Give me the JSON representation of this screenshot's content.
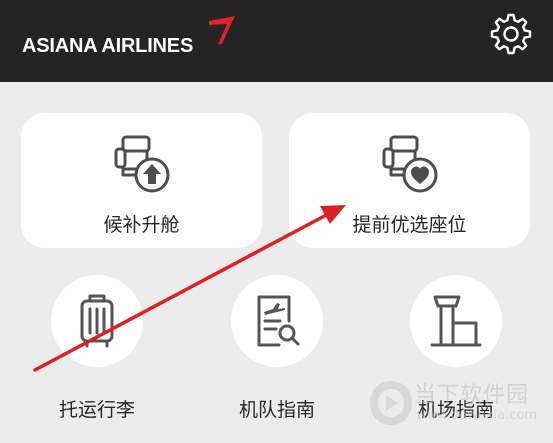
{
  "header": {
    "brand": "ASIANA AIRLINES",
    "brand_color": "#e3222b",
    "background": "#242424",
    "settings_icon": "gear-icon"
  },
  "cards": [
    {
      "label": "候补升舱",
      "icon": "seat-upgrade-arrow-icon"
    },
    {
      "label": "提前优选座位",
      "icon": "seat-heart-icon"
    }
  ],
  "services": [
    {
      "label": "托运行李",
      "icon": "luggage-icon"
    },
    {
      "label": "机队指南",
      "icon": "fleet-guide-document-icon"
    },
    {
      "label": "机场指南",
      "icon": "airport-tower-icon"
    }
  ],
  "annotation_color": "#e02020",
  "watermark": {
    "title": "当下软件园",
    "url": "www.downxia.com"
  }
}
